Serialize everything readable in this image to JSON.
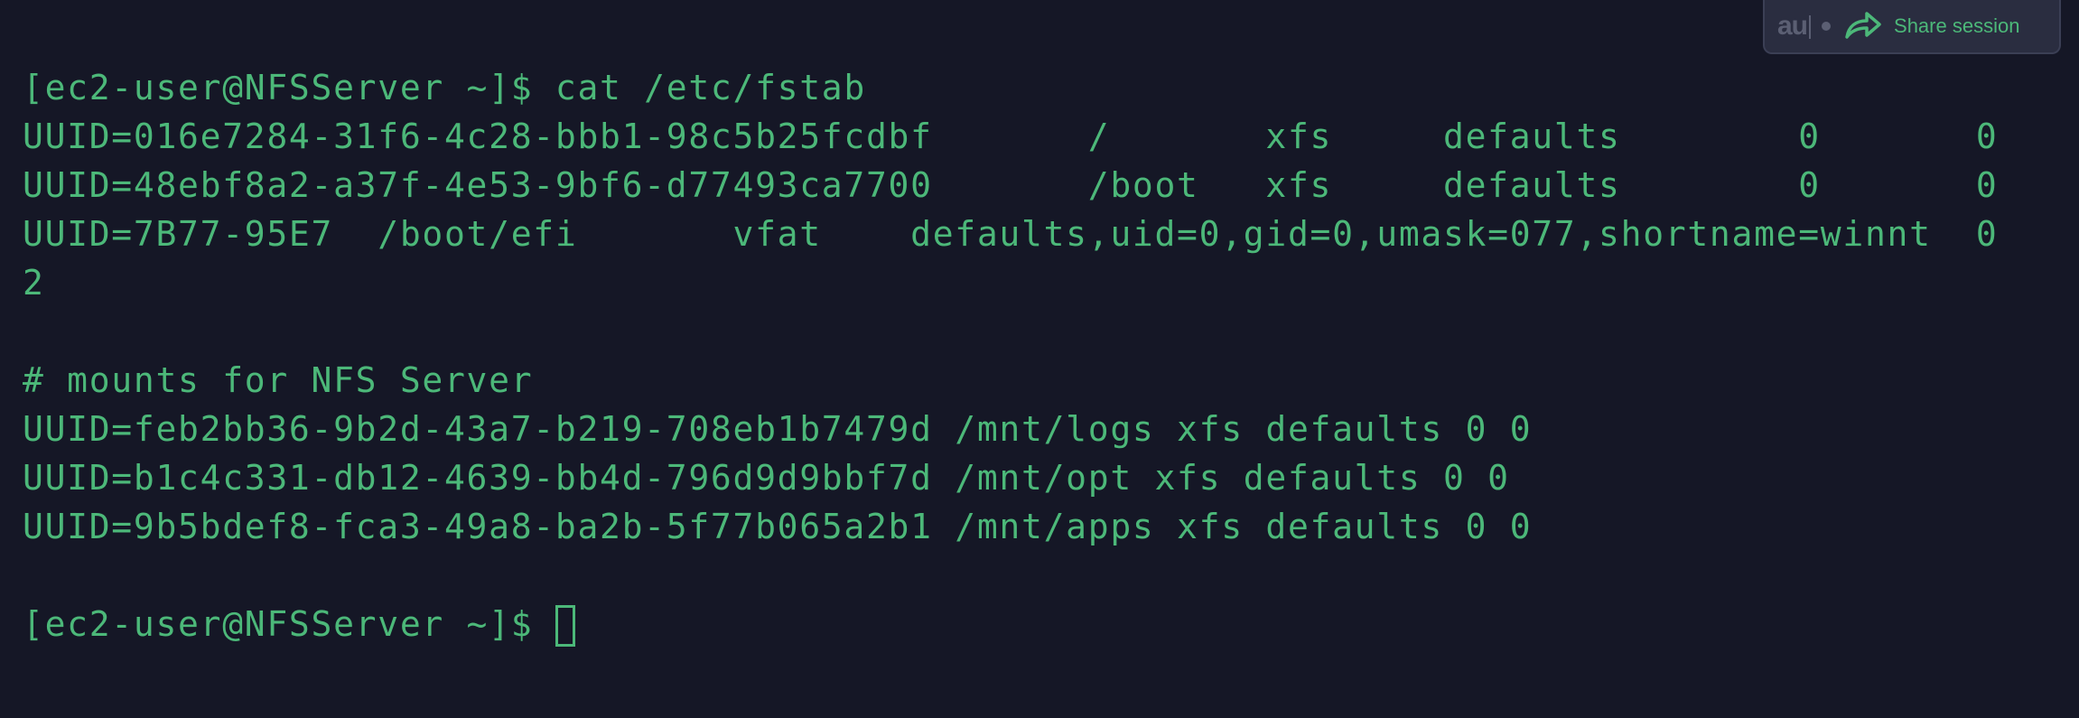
{
  "terminal": {
    "lines": [
      "[ec2-user@NFSServer ~]$ cat /etc/fstab",
      "UUID=016e7284-31f6-4c28-bbb1-98c5b25fcdbf       /       xfs     defaults        0       0",
      "UUID=48ebf8a2-a37f-4e53-9bf6-d77493ca7700       /boot   xfs     defaults        0       0",
      "UUID=7B77-95E7  /boot/efi       vfat    defaults,uid=0,gid=0,umask=077,shortname=winnt  0",
      "2",
      "",
      "# mounts for NFS Server",
      "UUID=feb2bb36-9b2d-43a7-b219-708eb1b7479d /mnt/logs xfs defaults 0 0",
      "UUID=b1c4c331-db12-4639-bb4d-796d9d9bbf7d /mnt/opt xfs defaults 0 0",
      "UUID=9b5bdef8-fca3-49a8-ba2b-5f77b065a2b1 /mnt/apps xfs defaults 0 0",
      ""
    ],
    "prompt": "[ec2-user@NFSServer ~]$ "
  },
  "share_widget": {
    "logo_text": "au",
    "share_label": "Share session"
  },
  "colors": {
    "background": "#151726",
    "text": "#4cb879",
    "widget_bg": "#2a2d40",
    "widget_muted": "#5b5f73"
  },
  "icons": {
    "share": "share-arrow-icon"
  }
}
